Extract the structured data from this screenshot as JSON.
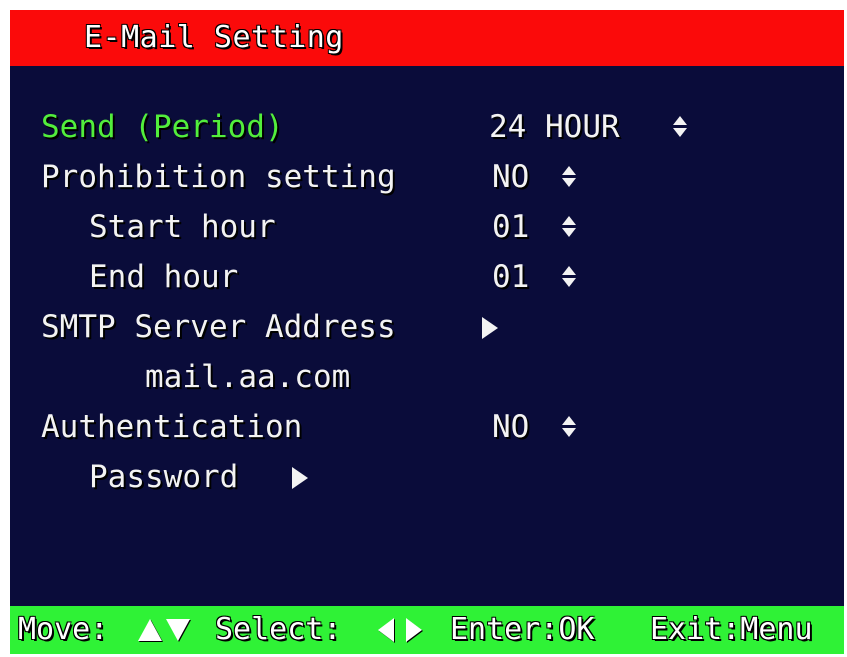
{
  "title": "E-Mail Setting",
  "menu": {
    "send_period": {
      "label": "Send (Period)",
      "value": "24 HOUR"
    },
    "prohibition": {
      "label": "Prohibition setting",
      "value": "NO"
    },
    "start_hour": {
      "label": "Start hour",
      "value": "01"
    },
    "end_hour": {
      "label": "End hour",
      "value": "01"
    },
    "smtp": {
      "label": "SMTP Server Address",
      "value": "mail.aa.com"
    },
    "authentication": {
      "label": "Authentication",
      "value": "NO"
    },
    "password": {
      "label": "Password"
    }
  },
  "help": {
    "move": "Move:",
    "select": "Select:",
    "enter": "Enter:OK",
    "exit": "Exit:Menu"
  },
  "colors": {
    "title_bg": "#fb0a0a",
    "screen_bg": "#0a0c3a",
    "help_bg": "#2ff236",
    "active_text": "#52ee3c",
    "text": "#f3f3f3"
  },
  "icons": {
    "value_spinner": "up-down-arrows-icon",
    "submenu": "arrow-right-icon",
    "move": "up-down-triangle-icon",
    "select": "left-right-triangle-icon"
  }
}
